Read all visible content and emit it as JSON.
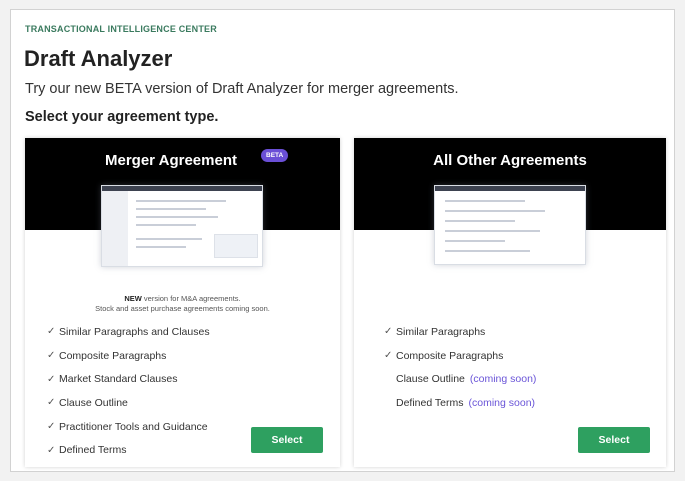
{
  "header": {
    "eyebrow": "TRANSACTIONAL INTELLIGENCE CENTER",
    "title": "Draft Analyzer",
    "subtitle": "Try our new BETA version of Draft Analyzer for merger agreements.",
    "prompt": "Select your agreement type."
  },
  "cards": [
    {
      "title": "Merger Agreement",
      "badge": "BETA",
      "note_new": "NEW",
      "note_line1_rest": " version for M&A agreements.",
      "note_line2": "Stock and asset purchase agreements coming soon.",
      "features": [
        {
          "label": "Similar Paragraphs and Clauses",
          "checked": true,
          "suffix": ""
        },
        {
          "label": "Composite Paragraphs",
          "checked": true,
          "suffix": ""
        },
        {
          "label": "Market Standard Clauses",
          "checked": true,
          "suffix": ""
        },
        {
          "label": "Clause Outline",
          "checked": true,
          "suffix": ""
        },
        {
          "label": "Practitioner Tools and Guidance",
          "checked": true,
          "suffix": ""
        },
        {
          "label": "Defined Terms",
          "checked": true,
          "suffix": ""
        }
      ],
      "button": "Select"
    },
    {
      "title": "All Other Agreements",
      "features": [
        {
          "label": "Similar Paragraphs",
          "checked": true,
          "suffix": ""
        },
        {
          "label": "Composite Paragraphs",
          "checked": true,
          "suffix": ""
        },
        {
          "label": "Clause Outline",
          "checked": false,
          "suffix": "(coming soon)"
        },
        {
          "label": "Defined Terms",
          "checked": false,
          "suffix": "(coming soon)"
        }
      ],
      "button": "Select"
    }
  ],
  "colors": {
    "accent_green": "#2ea060",
    "beta_purple": "#6a4fd6",
    "eyebrow_green": "#3a7a5e",
    "coming_soon": "#6a55d8"
  },
  "icons": {
    "check": "checkmark-icon"
  }
}
